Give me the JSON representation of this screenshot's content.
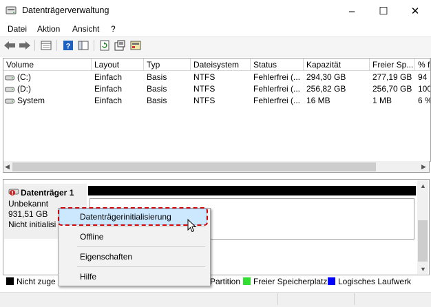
{
  "window": {
    "title": "Datenträgerverwaltung",
    "controls": {
      "minimize": "–",
      "maximize": "☐",
      "close": "✕"
    }
  },
  "menu": [
    "Datei",
    "Aktion",
    "Ansicht",
    "?"
  ],
  "toolbar": {
    "icons": [
      "back-icon",
      "forward-icon",
      "disk-list-icon",
      "help-icon",
      "console-icon",
      "refresh-icon",
      "properties-icon",
      "rescan-icon"
    ]
  },
  "table": {
    "columns": [
      "Volume",
      "Layout",
      "Typ",
      "Dateisystem",
      "Status",
      "Kapazität",
      "Freier Sp...",
      "% f"
    ],
    "rows": [
      [
        "(C:)",
        "Einfach",
        "Basis",
        "NTFS",
        "Fehlerfrei (...",
        "294,30 GB",
        "277,19 GB",
        "94"
      ],
      [
        "(D:)",
        "Einfach",
        "Basis",
        "NTFS",
        "Fehlerfrei (...",
        "256,82 GB",
        "256,70 GB",
        "100"
      ],
      [
        "System",
        "Einfach",
        "Basis",
        "NTFS",
        "Fehlerfrei (...",
        "16 MB",
        "1 MB",
        "6 %"
      ]
    ]
  },
  "disk": {
    "name": "Datenträger 1",
    "type": "Unbekannt",
    "size": "931,51 GB",
    "state": "Nicht initialisi"
  },
  "legend": [
    {
      "label": "Nicht zuge",
      "color": "#000000"
    },
    {
      "label": "Partition",
      "color": "#808080"
    },
    {
      "label": "Freier Speicherplatz",
      "color": "#33dd33"
    },
    {
      "label": "Logisches Laufwerk",
      "color": "#0000ff"
    }
  ],
  "context_menu": {
    "items": [
      "Datenträgerinitialisierung",
      "Offline",
      "Eigenschaften",
      "Hilfe"
    ],
    "highlight_color": "#d40000"
  }
}
